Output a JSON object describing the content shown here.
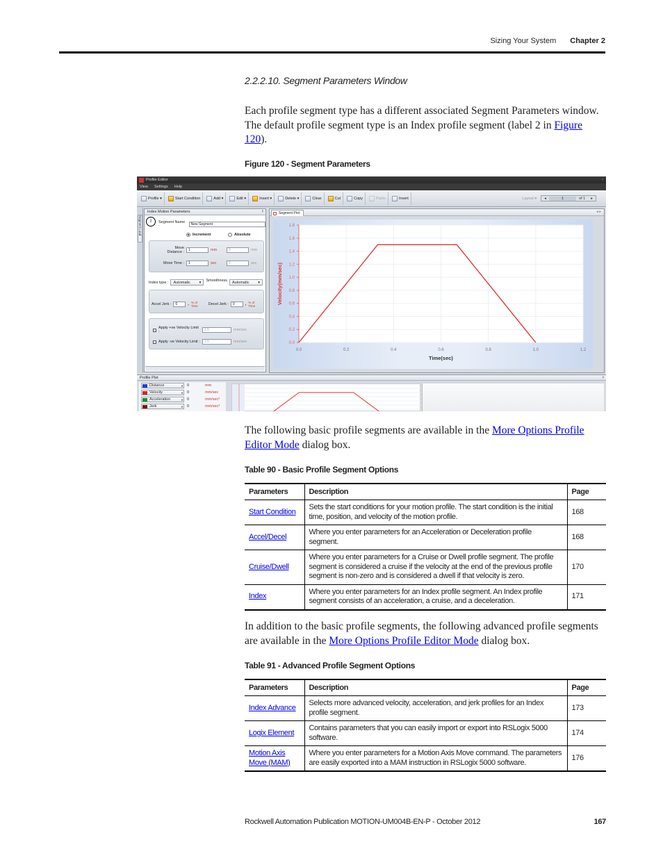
{
  "header": {
    "section": "Sizing Your System",
    "chapter": "Chapter 2"
  },
  "section_title": "2.2.2.10.  Segment Parameters Window",
  "paragraphs": {
    "p1_text": "Each profile segment type has a different associated Segment Parameters window. The default profile segment type is an Index profile segment (label 2 in ",
    "p1_link": "Figure 120",
    "p1_tail": ").",
    "p2_text": "The following basic profile segments are available in the ",
    "p2_link": "More Options Profile Editor Mode",
    "p2_tail": " dialog box.",
    "p3_text": "In addition to the basic profile segments, the following advanced profile segments are available in the ",
    "p3_link": "More Options Profile Editor Mode",
    "p3_tail": " dialog box."
  },
  "figure": {
    "caption": "Figure 120 - Segment Parameters",
    "app": {
      "title": "Profile Editor",
      "menu": [
        "View",
        "Settings",
        "Help"
      ],
      "toolbar": [
        {
          "label": "Profile ▾",
          "icon": "profile-icon"
        },
        {
          "label": "Start Condition",
          "icon": "start-condition-icon"
        },
        {
          "label": "Add ▾",
          "icon": "add-icon"
        },
        {
          "label": "Edit ▾",
          "icon": "edit-icon"
        },
        {
          "label": "Insert ▾",
          "icon": "insert-icon"
        },
        {
          "label": "Delete ▾",
          "icon": "delete-icon"
        },
        {
          "label": "Clear",
          "icon": "clear-icon"
        },
        {
          "label": "Cut",
          "icon": "cut-icon"
        },
        {
          "label": "Copy",
          "icon": "copy-icon"
        },
        {
          "label": "Paste",
          "icon": "paste-icon",
          "disabled": true
        },
        {
          "label": "Invert",
          "icon": "invert-icon"
        }
      ],
      "layout_label": "Layout ▾",
      "pager": {
        "prev": "◂",
        "current": "1",
        "of": "of 1",
        "next": "▸"
      },
      "side_tab": "Segment Load",
      "param_panel": {
        "title": "Index Motion Parameters",
        "pin": "ᵖ",
        "callout": "2",
        "segment_name_label": "Segment Name :",
        "segment_name_value": "New Segment",
        "radio_increment": "Increment",
        "radio_absolute": "Absolute",
        "move_distance_label": "Move Distance :",
        "move_distance_value": "1",
        "move_distance_unit": "mm",
        "move_distance_abs_value": "0",
        "move_distance_abs_unit": "mm",
        "move_time_label": "Move Time :",
        "move_time_value": "1",
        "move_time_unit": "sec",
        "move_time_abs_value": "0",
        "move_time_abs_unit": "sec",
        "index_type_label": "Index type :",
        "index_type_value": "Automatic",
        "smoothness_label": "Smoothness",
        "smoothness_value": "Automatic",
        "accel_jerk_label": "Accel Jerk :",
        "accel_jerk_value": "0",
        "accel_jerk_unit": "% of Time",
        "decel_jerk_label": "Decel Jerk :",
        "decel_jerk_value": "0",
        "decel_jerk_unit": "% of Time",
        "pos_vel_limit_label": "Apply +ve Velocity Limit :",
        "pos_vel_limit_value": "1.5",
        "pos_vel_limit_unit": "mm/sec",
        "neg_vel_limit_label": "Apply -ve Velocity Limit :",
        "neg_vel_limit_value": "1.5",
        "neg_vel_limit_unit": "mm/sec"
      },
      "plot_tab": "Segment Plot",
      "plot_nav": "◂ ▸",
      "profile_plot_title": "Profile Plot",
      "legend": [
        {
          "name": "Distance",
          "value": "0",
          "unit": "mm",
          "color": "#1a3fe0"
        },
        {
          "name": "Velocity",
          "value": "0",
          "unit": "mm/sec",
          "color": "#e02020"
        },
        {
          "name": "Acceleration",
          "value": "0",
          "unit": "mm/sec²",
          "color": "#1a8c2a"
        },
        {
          "name": "Jerk",
          "value": "0",
          "unit": "mm/sec³",
          "color": "#7a1010"
        }
      ]
    }
  },
  "chart_data": {
    "type": "line",
    "title": "",
    "xlabel": "Time(sec)",
    "ylabel": "Velocity(mm/sec)",
    "xlim": [
      0,
      1.2
    ],
    "ylim": [
      0,
      1.8
    ],
    "x_ticks": [
      "0.0",
      "0.2",
      "0.4",
      "0.6",
      "0.8",
      "1.0",
      "1.2"
    ],
    "y_ticks": [
      "0.0",
      "0.2",
      "0.4",
      "0.6",
      "0.8",
      "1.0",
      "1.2",
      "1.4",
      "1.6",
      "1.8"
    ],
    "grid": true,
    "series": [
      {
        "name": "Velocity",
        "color": "#e03030",
        "x": [
          0,
          0.333,
          0.667,
          1.0
        ],
        "y": [
          0,
          1.5,
          1.5,
          0
        ]
      }
    ]
  },
  "table90": {
    "caption": "Table 90 - Basic Profile Segment Options",
    "headers": [
      "Parameters",
      "Description",
      "Page"
    ],
    "rows": [
      {
        "param": "Start Condition",
        "desc": "Sets the start conditions for your motion profile. The start condition is the initial time, position, and velocity of the motion profile.",
        "page": "168"
      },
      {
        "param": "Accel/Decel",
        "desc": "Where you enter parameters for an Acceleration or Deceleration profile segment.",
        "page": "168"
      },
      {
        "param": "Cruise/Dwell",
        "desc": "Where you enter parameters for a Cruise or Dwell profile segment. The profile segment is considered a cruise if the velocity at the end of the previous profile segment is non-zero and is considered a dwell if that velocity is zero.",
        "page": "170"
      },
      {
        "param": "Index",
        "desc": "Where you enter parameters for an Index profile segment. An Index profile segment consists of an acceleration, a cruise, and a deceleration.",
        "page": "171"
      }
    ]
  },
  "table91": {
    "caption": "Table 91 - Advanced Profile Segment Options",
    "headers": [
      "Parameters",
      "Description",
      "Page"
    ],
    "rows": [
      {
        "param": "Index Advance",
        "desc": "Selects more advanced velocity, acceleration, and jerk profiles for an Index profile segment.",
        "page": "173"
      },
      {
        "param": "Logix Element",
        "desc": "Contains parameters that you can easily import or export into RSLogix 5000 software.",
        "page": "174"
      },
      {
        "param": "Motion Axis Move (MAM)",
        "desc": "Where you enter parameters for a Motion Axis Move command. The parameters are easily exported into a MAM instruction in RSLogix 5000 software.",
        "page": "176"
      }
    ]
  },
  "footer": {
    "publication": "Rockwell Automation Publication MOTION-UM004B-EN-P - October 2012",
    "page_number": "167"
  }
}
